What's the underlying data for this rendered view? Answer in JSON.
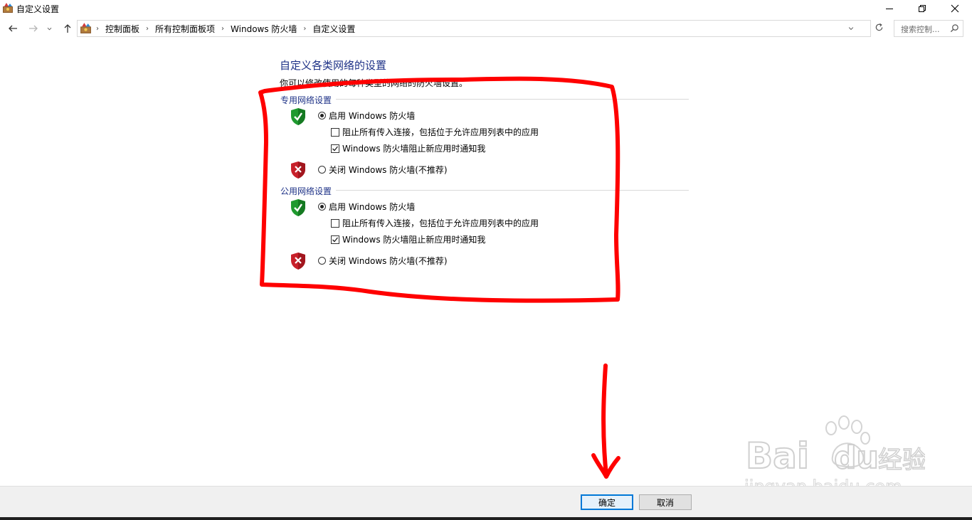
{
  "window": {
    "title": "自定义设置"
  },
  "addressbar": {
    "crumbs": [
      "控制面板",
      "所有控制面板项",
      "Windows 防火墙",
      "自定义设置"
    ],
    "search_placeholder": "搜索控制..."
  },
  "main": {
    "title": "自定义各类网络的设置",
    "description": "你可以修改使用的每种类型的网络的防火墙设置。",
    "private": {
      "heading": "专用网络设置",
      "enable_label": "启用 Windows 防火墙",
      "block_all_label": "阻止所有传入连接，包括位于允许应用列表中的应用",
      "notify_label": "Windows 防火墙阻止新应用时通知我",
      "disable_label": "关闭 Windows 防火墙(不推荐)",
      "enabled": true,
      "block_all_checked": false,
      "notify_checked": true
    },
    "public": {
      "heading": "公用网络设置",
      "enable_label": "启用 Windows 防火墙",
      "block_all_label": "阻止所有传入连接，包括位于允许应用列表中的应用",
      "notify_label": "Windows 防火墙阻止新应用时通知我",
      "disable_label": "关闭 Windows 防火墙(不推荐)",
      "enabled": true,
      "block_all_checked": false,
      "notify_checked": true
    }
  },
  "footer": {
    "ok_label": "确定",
    "cancel_label": "取消"
  },
  "watermark": {
    "brand": "Baidu经验",
    "url": "jingyan.baidu.com"
  },
  "colors": {
    "heading_blue": "#1e3287",
    "annotation_red": "#ff0000",
    "shield_green": "#1f9a2f",
    "shield_red": "#c8202a",
    "default_button_border": "#0078d7"
  }
}
